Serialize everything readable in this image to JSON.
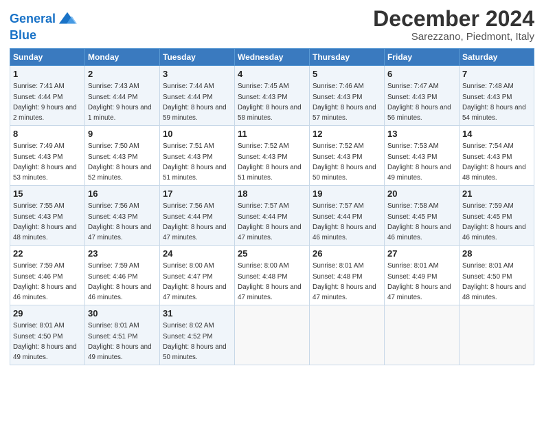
{
  "header": {
    "logo_line1": "General",
    "logo_line2": "Blue",
    "month": "December 2024",
    "location": "Sarezzano, Piedmont, Italy"
  },
  "weekdays": [
    "Sunday",
    "Monday",
    "Tuesday",
    "Wednesday",
    "Thursday",
    "Friday",
    "Saturday"
  ],
  "weeks": [
    [
      {
        "day": "1",
        "sunrise": "7:41 AM",
        "sunset": "4:44 PM",
        "daylight": "9 hours and 2 minutes."
      },
      {
        "day": "2",
        "sunrise": "7:43 AM",
        "sunset": "4:44 PM",
        "daylight": "9 hours and 1 minute."
      },
      {
        "day": "3",
        "sunrise": "7:44 AM",
        "sunset": "4:44 PM",
        "daylight": "8 hours and 59 minutes."
      },
      {
        "day": "4",
        "sunrise": "7:45 AM",
        "sunset": "4:43 PM",
        "daylight": "8 hours and 58 minutes."
      },
      {
        "day": "5",
        "sunrise": "7:46 AM",
        "sunset": "4:43 PM",
        "daylight": "8 hours and 57 minutes."
      },
      {
        "day": "6",
        "sunrise": "7:47 AM",
        "sunset": "4:43 PM",
        "daylight": "8 hours and 56 minutes."
      },
      {
        "day": "7",
        "sunrise": "7:48 AM",
        "sunset": "4:43 PM",
        "daylight": "8 hours and 54 minutes."
      }
    ],
    [
      {
        "day": "8",
        "sunrise": "7:49 AM",
        "sunset": "4:43 PM",
        "daylight": "8 hours and 53 minutes."
      },
      {
        "day": "9",
        "sunrise": "7:50 AM",
        "sunset": "4:43 PM",
        "daylight": "8 hours and 52 minutes."
      },
      {
        "day": "10",
        "sunrise": "7:51 AM",
        "sunset": "4:43 PM",
        "daylight": "8 hours and 51 minutes."
      },
      {
        "day": "11",
        "sunrise": "7:52 AM",
        "sunset": "4:43 PM",
        "daylight": "8 hours and 51 minutes."
      },
      {
        "day": "12",
        "sunrise": "7:52 AM",
        "sunset": "4:43 PM",
        "daylight": "8 hours and 50 minutes."
      },
      {
        "day": "13",
        "sunrise": "7:53 AM",
        "sunset": "4:43 PM",
        "daylight": "8 hours and 49 minutes."
      },
      {
        "day": "14",
        "sunrise": "7:54 AM",
        "sunset": "4:43 PM",
        "daylight": "8 hours and 48 minutes."
      }
    ],
    [
      {
        "day": "15",
        "sunrise": "7:55 AM",
        "sunset": "4:43 PM",
        "daylight": "8 hours and 48 minutes."
      },
      {
        "day": "16",
        "sunrise": "7:56 AM",
        "sunset": "4:43 PM",
        "daylight": "8 hours and 47 minutes."
      },
      {
        "day": "17",
        "sunrise": "7:56 AM",
        "sunset": "4:44 PM",
        "daylight": "8 hours and 47 minutes."
      },
      {
        "day": "18",
        "sunrise": "7:57 AM",
        "sunset": "4:44 PM",
        "daylight": "8 hours and 47 minutes."
      },
      {
        "day": "19",
        "sunrise": "7:57 AM",
        "sunset": "4:44 PM",
        "daylight": "8 hours and 46 minutes."
      },
      {
        "day": "20",
        "sunrise": "7:58 AM",
        "sunset": "4:45 PM",
        "daylight": "8 hours and 46 minutes."
      },
      {
        "day": "21",
        "sunrise": "7:59 AM",
        "sunset": "4:45 PM",
        "daylight": "8 hours and 46 minutes."
      }
    ],
    [
      {
        "day": "22",
        "sunrise": "7:59 AM",
        "sunset": "4:46 PM",
        "daylight": "8 hours and 46 minutes."
      },
      {
        "day": "23",
        "sunrise": "7:59 AM",
        "sunset": "4:46 PM",
        "daylight": "8 hours and 46 minutes."
      },
      {
        "day": "24",
        "sunrise": "8:00 AM",
        "sunset": "4:47 PM",
        "daylight": "8 hours and 47 minutes."
      },
      {
        "day": "25",
        "sunrise": "8:00 AM",
        "sunset": "4:48 PM",
        "daylight": "8 hours and 47 minutes."
      },
      {
        "day": "26",
        "sunrise": "8:01 AM",
        "sunset": "4:48 PM",
        "daylight": "8 hours and 47 minutes."
      },
      {
        "day": "27",
        "sunrise": "8:01 AM",
        "sunset": "4:49 PM",
        "daylight": "8 hours and 47 minutes."
      },
      {
        "day": "28",
        "sunrise": "8:01 AM",
        "sunset": "4:50 PM",
        "daylight": "8 hours and 48 minutes."
      }
    ],
    [
      {
        "day": "29",
        "sunrise": "8:01 AM",
        "sunset": "4:50 PM",
        "daylight": "8 hours and 49 minutes."
      },
      {
        "day": "30",
        "sunrise": "8:01 AM",
        "sunset": "4:51 PM",
        "daylight": "8 hours and 49 minutes."
      },
      {
        "day": "31",
        "sunrise": "8:02 AM",
        "sunset": "4:52 PM",
        "daylight": "8 hours and 50 minutes."
      },
      null,
      null,
      null,
      null
    ]
  ]
}
